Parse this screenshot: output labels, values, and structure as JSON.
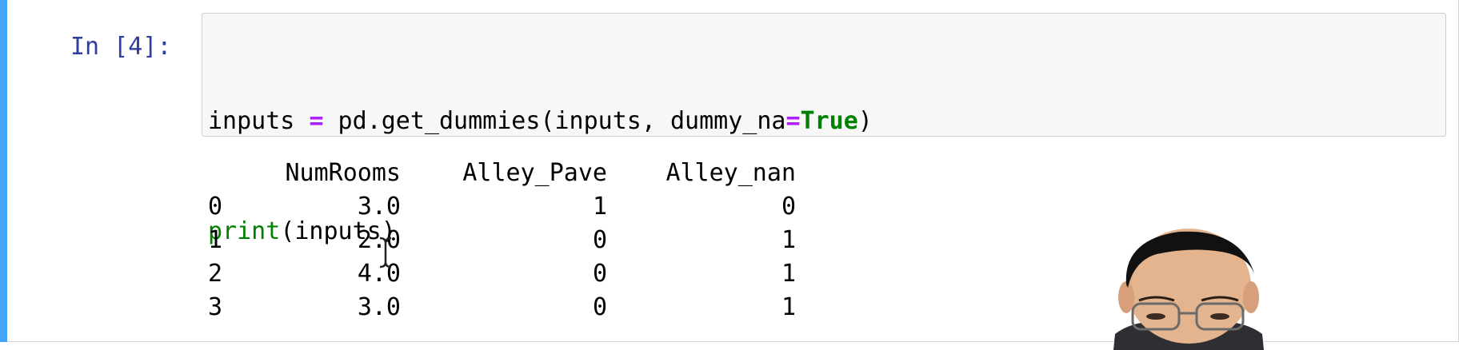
{
  "cell": {
    "prompt": "In [4]:",
    "code_lines": [
      [
        "inputs ",
        "=",
        " pd.get_dummies(inputs, dummy_na",
        "=",
        "True",
        ")"
      ],
      [
        "print",
        "(inputs)"
      ]
    ],
    "output": {
      "columns": [
        "",
        "NumRooms",
        "Alley_Pave",
        "Alley_nan"
      ],
      "rows": [
        [
          "0",
          "3.0",
          "1",
          "0"
        ],
        [
          "1",
          "2.0",
          "0",
          "1"
        ],
        [
          "2",
          "4.0",
          "0",
          "1"
        ],
        [
          "3",
          "3.0",
          "0",
          "1"
        ]
      ]
    }
  },
  "colors": {
    "selected_bar": "#42a5f5",
    "prompt": "#303f9f",
    "operator": "#aa22ff",
    "keyword": "#008000",
    "input_bg": "#f7f7f7"
  },
  "icons": {
    "cursor": "i-beam-cursor-icon",
    "webcam": "presenter-webcam"
  }
}
